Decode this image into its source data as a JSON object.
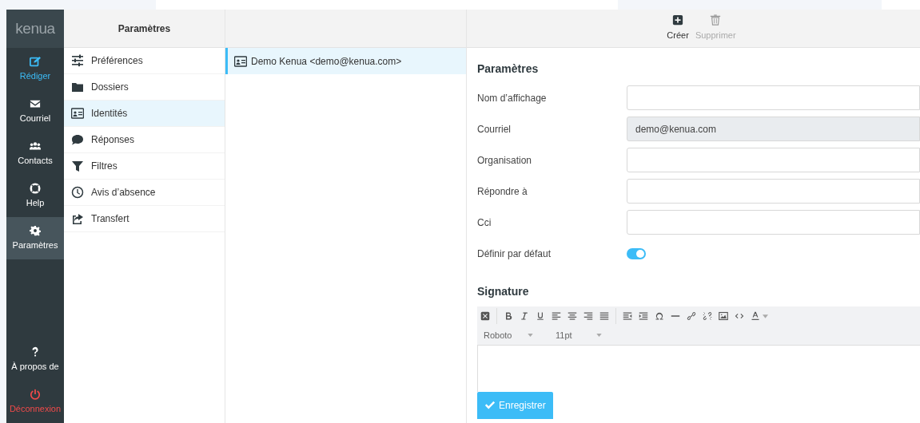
{
  "logo": {
    "text": "kenua"
  },
  "nav": [
    {
      "label": "Rédiger",
      "kind": "accent",
      "selected": false
    },
    {
      "label": "Courriel",
      "kind": "normal",
      "selected": false
    },
    {
      "label": "Contacts",
      "kind": "normal",
      "selected": false
    },
    {
      "label": "Help",
      "kind": "normal",
      "selected": false
    },
    {
      "label": "Paramètres",
      "kind": "normal",
      "selected": true
    }
  ],
  "nav_bottom": [
    {
      "label": "À propos de",
      "kind": "normal"
    },
    {
      "label": "Déconnexion",
      "kind": "danger"
    }
  ],
  "settings": {
    "title": "Paramètres",
    "items": [
      {
        "label": "Préférences",
        "selected": false
      },
      {
        "label": "Dossiers",
        "selected": false
      },
      {
        "label": "Identités",
        "selected": true
      },
      {
        "label": "Réponses",
        "selected": false
      },
      {
        "label": "Filtres",
        "selected": false
      },
      {
        "label": "Avis d’absence",
        "selected": false
      },
      {
        "label": "Transfert",
        "selected": false
      }
    ]
  },
  "identities": [
    {
      "label": "Demo Kenua <demo@kenua.com>",
      "selected": true
    }
  ],
  "toolbar": [
    {
      "label": "Créer",
      "disabled": false
    },
    {
      "label": "Supprimer",
      "disabled": true
    }
  ],
  "form": {
    "title": "Paramètres",
    "fields": [
      {
        "label": "Nom d’affichage",
        "kind": "text",
        "disabled": false
      },
      {
        "label": "Courriel",
        "kind": "text",
        "value": "demo@kenua.com",
        "disabled": true
      },
      {
        "label": "Organisation",
        "kind": "text",
        "disabled": false
      },
      {
        "label": "Répondre à",
        "kind": "text",
        "disabled": false
      },
      {
        "label": "Cci",
        "kind": "text",
        "disabled": false
      },
      {
        "label": "Définir par défaut",
        "kind": "toggle",
        "on": true
      }
    ]
  },
  "signature": {
    "title": "Signature",
    "font": "Roboto",
    "size": "11pt"
  },
  "save_button": "Enregistrer"
}
